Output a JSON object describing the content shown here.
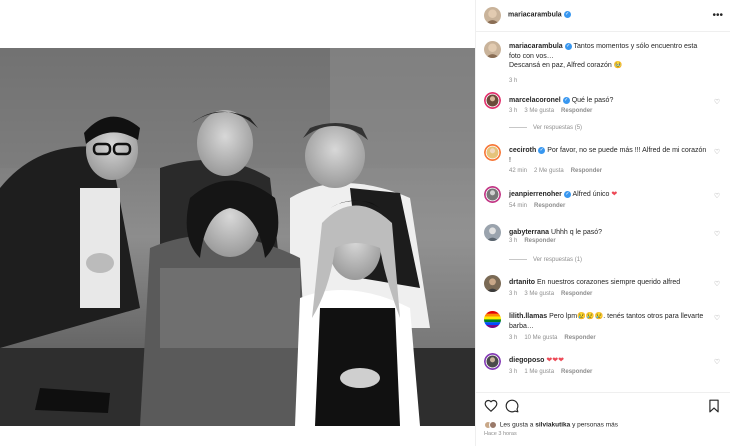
{
  "post": {
    "author": "mariacarambula",
    "time_ago": "Hace 3 horas"
  },
  "caption": {
    "author": "mariacarambula",
    "text": "Tantos momentos y sólo encuentro esta foto con vos…",
    "text2": "Descansá en paz, Alfred corazón 🥹",
    "time": "3 h"
  },
  "comments": [
    {
      "user": "marcelacoronel",
      "verified": true,
      "text": "Qué le pasó?",
      "time": "3 h",
      "likes": "3 Me gusta",
      "reply": "Responder",
      "view_replies": "Ver respuestas (5)"
    },
    {
      "user": "ceciroth",
      "verified": true,
      "text": "Por favor, no se puede más !!! Alfred de mi corazón !",
      "time": "42 min",
      "likes": "2 Me gusta",
      "reply": "Responder"
    },
    {
      "user": "jeanpierrenoher",
      "verified": true,
      "text": "Alfred único",
      "heart": "❤",
      "time": "54 min",
      "reply": "Responder"
    },
    {
      "user": "gabyterrana",
      "verified": false,
      "text": "Uhhh q le pasó?",
      "time": "3 h",
      "reply": "Responder",
      "view_replies": "Ver respuestas (1)"
    },
    {
      "user": "drtanito",
      "verified": false,
      "text": "En nuestros corazones siempre querido alfred",
      "time": "3 h",
      "likes": "3 Me gusta",
      "reply": "Responder"
    },
    {
      "user": "lilith.llamas",
      "verified": false,
      "text": "Pero lpm😢😢😢. tenés tantos otros para llevarte barba…",
      "time": "3 h",
      "likes": "10 Me gusta",
      "reply": "Responder"
    },
    {
      "user": "diegoposo",
      "verified": false,
      "text": "❤❤❤",
      "time": "3 h",
      "likes": "1 Me gusta",
      "reply": "Responder"
    }
  ],
  "likes_line": {
    "prefix": "Les gusta a",
    "user": "silviakutika",
    "suffix": "y personas más"
  },
  "icons": {
    "more": "more-options-icon",
    "like": "heart-icon",
    "comment": "comment-icon",
    "save": "bookmark-icon"
  },
  "colors": {
    "verified": "#3897f0",
    "heart_red": "#ed4956",
    "muted": "#8e8e8e",
    "photo_bg": "#1a1a1a"
  }
}
